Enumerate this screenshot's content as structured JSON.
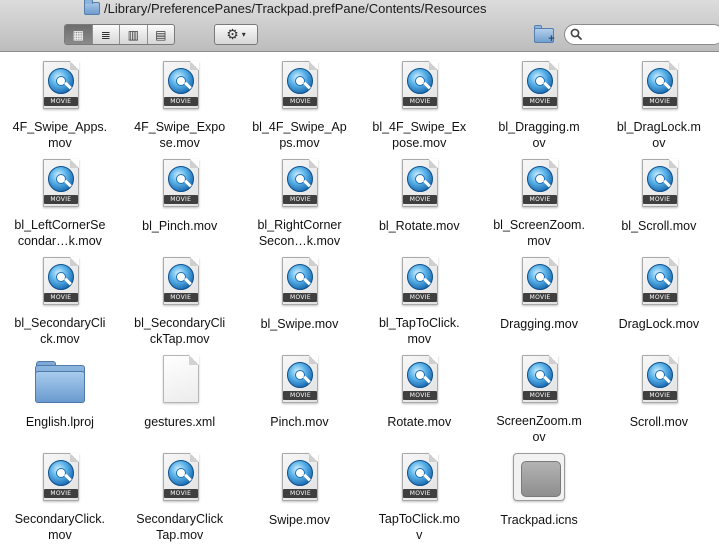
{
  "window": {
    "path": "/Library/PreferencePanes/Trackpad.prefPane/Contents/Resources"
  },
  "toolbar": {
    "view_modes": [
      {
        "name": "icon-view",
        "glyph": "▦",
        "active": true
      },
      {
        "name": "list-view",
        "glyph": "≣",
        "active": false
      },
      {
        "name": "column-view",
        "glyph": "▥",
        "active": false
      },
      {
        "name": "coverflow-view",
        "glyph": "▤",
        "active": false
      }
    ],
    "action_glyph": "⚙",
    "action_caret": "▾",
    "new_folder_plus": "+",
    "search": {
      "value": "",
      "placeholder": ""
    }
  },
  "files": [
    {
      "label": "4F_Swipe_Apps.\nmov",
      "kind": "movie"
    },
    {
      "label": "4F_Swipe_Expo\nse.mov",
      "kind": "movie"
    },
    {
      "label": "bl_4F_Swipe_Ap\nps.mov",
      "kind": "movie"
    },
    {
      "label": "bl_4F_Swipe_Ex\npose.mov",
      "kind": "movie"
    },
    {
      "label": "bl_Dragging.m\nov",
      "kind": "movie"
    },
    {
      "label": "bl_DragLock.m\nov",
      "kind": "movie"
    },
    {
      "label": "bl_LeftCornerSe\ncondar…k.mov",
      "kind": "movie"
    },
    {
      "label": "bl_Pinch.mov",
      "kind": "movie"
    },
    {
      "label": "bl_RightCorner\nSecon…k.mov",
      "kind": "movie"
    },
    {
      "label": "bl_Rotate.mov",
      "kind": "movie"
    },
    {
      "label": "bl_ScreenZoom.\nmov",
      "kind": "movie"
    },
    {
      "label": "bl_Scroll.mov",
      "kind": "movie"
    },
    {
      "label": "bl_SecondaryCli\nck.mov",
      "kind": "movie"
    },
    {
      "label": "bl_SecondaryCli\nckTap.mov",
      "kind": "movie"
    },
    {
      "label": "bl_Swipe.mov",
      "kind": "movie"
    },
    {
      "label": "bl_TapToClick.\nmov",
      "kind": "movie"
    },
    {
      "label": "Dragging.mov",
      "kind": "movie"
    },
    {
      "label": "DragLock.mov",
      "kind": "movie"
    },
    {
      "label": "English.lproj",
      "kind": "folder"
    },
    {
      "label": "gestures.xml",
      "kind": "document"
    },
    {
      "label": "Pinch.mov",
      "kind": "movie"
    },
    {
      "label": "Rotate.mov",
      "kind": "movie"
    },
    {
      "label": "ScreenZoom.m\nov",
      "kind": "movie"
    },
    {
      "label": "Scroll.mov",
      "kind": "movie"
    },
    {
      "label": "SecondaryClick.\nmov",
      "kind": "movie"
    },
    {
      "label": "SecondaryClick\nTap.mov",
      "kind": "movie"
    },
    {
      "label": "Swipe.mov",
      "kind": "movie"
    },
    {
      "label": "TapToClick.mo\nv",
      "kind": "movie"
    },
    {
      "label": "Trackpad.icns",
      "kind": "icns"
    }
  ],
  "icon_badges": {
    "movie": "MOVIE"
  }
}
